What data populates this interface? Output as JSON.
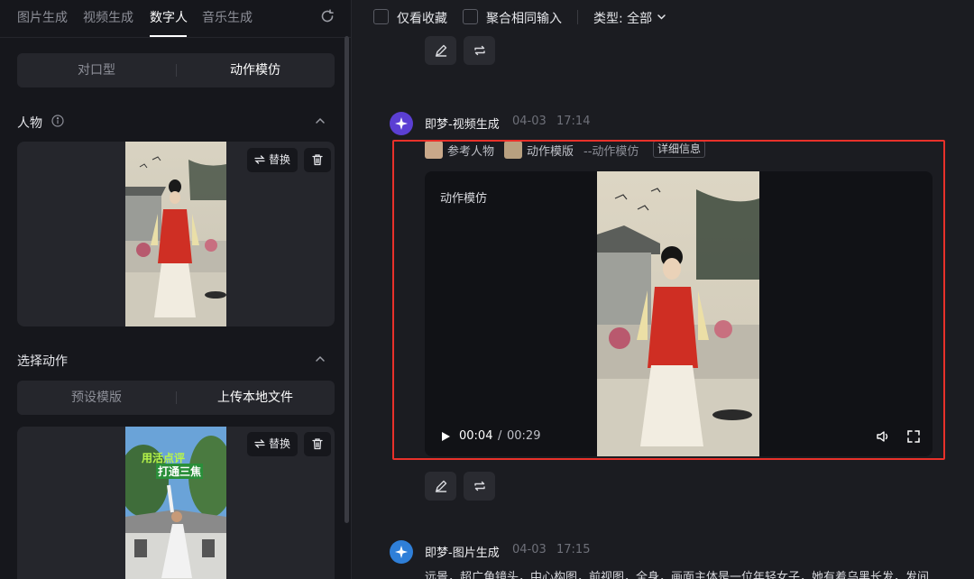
{
  "colors": {
    "accent": "#ffffff",
    "highlight_box": "#e8312a",
    "panel_bg": "#16171c",
    "card_bg": "#25262c"
  },
  "left_panel": {
    "tabs": [
      {
        "label": "图片生成",
        "active": false
      },
      {
        "label": "视频生成",
        "active": false
      },
      {
        "label": "数字人",
        "active": true
      },
      {
        "label": "音乐生成",
        "active": false
      }
    ],
    "refresh_icon": "refresh-icon",
    "mode_toggle": {
      "options": [
        "对口型",
        "动作模仿"
      ],
      "selected": "动作模仿"
    },
    "character_section": {
      "title": "人物",
      "replace_label": "替换"
    },
    "action_section": {
      "title": "选择动作",
      "options": [
        "预设模版",
        "上传本地文件"
      ],
      "replace_label": "替换",
      "thumb_caption_line1": "用活点评",
      "thumb_caption_line2": "打通三焦"
    }
  },
  "topbar": {
    "only_favorites": "仅看收藏",
    "merge_same_input": "聚合相同输入",
    "type_filter": "类型: 全部"
  },
  "messages": [
    {
      "name": "即梦-视频生成",
      "date": "04-03",
      "time": "17:14",
      "ref_person": "参考人物",
      "ref_template": "动作模版",
      "ref_suffix": "--动作模仿",
      "detail_label": "详细信息",
      "video": {
        "label": "动作模仿",
        "current_time": "00:04",
        "separator": "/",
        "duration": "00:29"
      }
    },
    {
      "name": "即梦-图片生成",
      "date": "04-03",
      "time": "17:15",
      "prompt": "远景，超广角镜头，中心构图，前视图，全身，画面主体是一位年轻女子，她有着乌黑长发，发间"
    }
  ]
}
